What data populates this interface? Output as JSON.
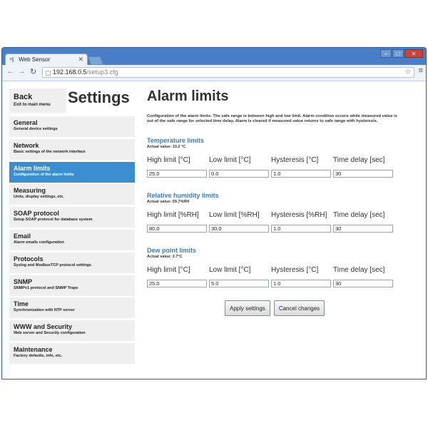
{
  "browser": {
    "tab_title": "Web Sensor",
    "url_host": "192.168.0.5",
    "url_path": "/setup3.cfg"
  },
  "sidebar": {
    "back_label": "Back",
    "back_sub": "Exit to main menu",
    "title": "Settings",
    "items": [
      {
        "label": "General",
        "sub": "General device settings"
      },
      {
        "label": "Network",
        "sub": "Basic settings of the network interface"
      },
      {
        "label": "Alarm limits",
        "sub": "Configuration of the alarm limits"
      },
      {
        "label": "Measuring",
        "sub": "Units, display settings, etc."
      },
      {
        "label": "SOAP protocol",
        "sub": "Setup SOAP protocol for database system"
      },
      {
        "label": "Email",
        "sub": "Alarm emails configuration"
      },
      {
        "label": "Protocols",
        "sub": "Syslog and ModbusTCP protocol settings"
      },
      {
        "label": "SNMP",
        "sub": "SNMPv1 protocol and SNMP Traps"
      },
      {
        "label": "Time",
        "sub": "Synchronization with NTP server"
      },
      {
        "label": "WWW and Security",
        "sub": "Web server and Security configuration"
      },
      {
        "label": "Maintenance",
        "sub": "Factory defaults, info, etc."
      }
    ],
    "active_index": 2
  },
  "main": {
    "title": "Alarm limits",
    "description": "Configuration of the alarm limits. The safe range is between high and low limit. Alarm condition occurs while measured value is out of the safe range for selected time delay. Alarm is cleared if measured value returns to safe range with hysteresis.",
    "sections": [
      {
        "title": "Temperature limits",
        "actual": "Actual value: 10.2 °C",
        "labels": [
          "High limit [°C]",
          "Low limit [°C]",
          "Hysteresis [°C]",
          "Time delay [sec]"
        ],
        "values": [
          "25.0",
          "0.0",
          "1.0",
          "30"
        ]
      },
      {
        "title": "Relative humidity limits",
        "actual": "Actual value: 59.7%RH",
        "labels": [
          "High limit [%RH]",
          "Low limit [%RH]",
          "Hysteresis [%RH]",
          "Time delay [sec]"
        ],
        "values": [
          "80.0",
          "30.0",
          "1.0",
          "30"
        ]
      },
      {
        "title": "Dew point limits",
        "actual": "Actual value: 2.7°C",
        "labels": [
          "High limit [°C]",
          "Low limit [°C]",
          "Hysteresis [°C]",
          "Time delay [sec]"
        ],
        "values": [
          "25.0",
          "5.0",
          "1.0",
          "30"
        ]
      }
    ],
    "apply_label": "Apply settings",
    "cancel_label": "Cancel changes"
  },
  "icons": {
    "back": "arrow-left",
    "forward": "arrow-right",
    "reload": "reload",
    "page": "page",
    "star": "star",
    "menu": "hamburger-menu"
  }
}
